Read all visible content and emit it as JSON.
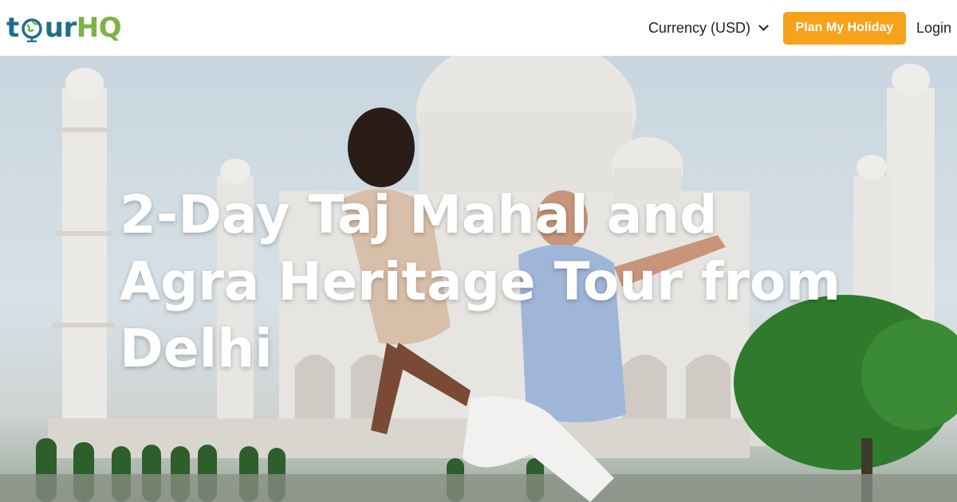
{
  "brand": {
    "logo_text_prefix": "t",
    "logo_text_mid": "ur",
    "logo_text_suffix": "HQ"
  },
  "nav": {
    "currency_label": "Currency (USD)",
    "plan_button_label": "Plan My Holiday",
    "login_label": "Login"
  },
  "hero": {
    "title": "2-Day Taj Mahal and Agra Heritage Tour from Delhi"
  },
  "colors": {
    "accent": "#f7a21b",
    "logo_blue": "#1f6f8b",
    "logo_green": "#7cb342"
  },
  "icons": {
    "currency_dropdown": "chevron-down-icon",
    "logo_globe": "globe-icon"
  }
}
